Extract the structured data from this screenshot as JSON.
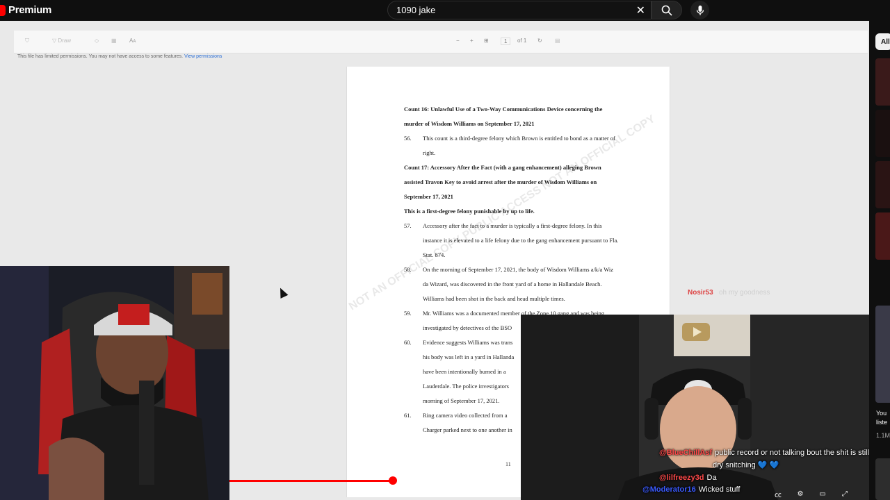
{
  "header": {
    "brand": "Premium",
    "search_value": "1090 jake",
    "icons": {
      "clear": "close-icon",
      "search": "search-icon",
      "voice": "mic-icon"
    }
  },
  "viewer": {
    "toolbar": {
      "draw_label": "Draw",
      "aa_label": "Aᴀ",
      "page_value": "1",
      "page_total": "of 1"
    },
    "notice": "This file has limited permissions. You may not have access to some features.",
    "notice_link": "View permissions"
  },
  "document": {
    "lines": [
      {
        "t": "Count 16: Unlawful Use of a Two-Way Communications Device concerning the",
        "b": true
      },
      {
        "t": "murder of Wisdom Williams on September 17, 2021",
        "b": true
      },
      {
        "n": "56.",
        "t": "This count is a third-degree felony which Brown is entitled to bond as a matter of"
      },
      {
        "t": "right.",
        "i": true
      },
      {
        "t": "Count 17: Accessory After the Fact (with a gang enhancement) alleging Brown",
        "b": true
      },
      {
        "t": "assisted Travon Key to avoid arrest after the murder of Wisdom Williams on",
        "b": true
      },
      {
        "t": "September 17, 2021",
        "b": true
      },
      {
        "t": "This is a first-degree felony punishable by up to life.",
        "b": true
      },
      {
        "n": "57.",
        "t": "Accessory after the fact to a murder is typically a first-degree felony.  In this"
      },
      {
        "t": "instance it is elevated to a life felony due to the gang enhancement pursuant to Fla.",
        "i": true
      },
      {
        "t": "Stat. 874.",
        "i": true
      },
      {
        "n": "58.",
        "t": "On the morning of September 17, 2021, the body of Wisdom Williams a/k/a Wiz"
      },
      {
        "t": "da Wizard, was discovered in the front yard of a home in Hallandale Beach.",
        "i": true
      },
      {
        "t": "Williams had been shot in the back and head multiple times.",
        "i": true
      },
      {
        "n": "59.",
        "t": "Mr. Williams was a documented member of the Zone 10 gang and was being"
      },
      {
        "t": "investigated by detectives of the BSO",
        "i": true
      },
      {
        "n": "60.",
        "t": "Evidence suggests Williams was trans"
      },
      {
        "t": "his body was left in a yard in Hallanda",
        "i": true
      },
      {
        "t": "have been intentionally burned in a",
        "i": true
      },
      {
        "t": "Lauderdale.  The police investigators",
        "i": true
      },
      {
        "t": "morning of September 17, 2021.",
        "i": true
      },
      {
        "n": "61.",
        "t": "Ring camera video collected from a"
      },
      {
        "t": "Charger parked next to one another in",
        "i": true
      }
    ],
    "page_number": "11",
    "watermark": "NOT AN OFFICIAL COPY   PUBLIC ACCESS   NOT AN OFFICIAL COPY"
  },
  "chat": {
    "overlay": {
      "user": "Nosir53",
      "text": "oh my goodness"
    },
    "messages": [
      {
        "user": "@BlueChillAsf",
        "text": "public record or not talking bout the shit is still"
      },
      {
        "user": "",
        "text": "dry snitching 💙 💙"
      },
      {
        "user": "@lilfreezy3d",
        "text": "Da"
      },
      {
        "user": "@Moderator16",
        "text": "Wicked stuff"
      }
    ]
  },
  "player": {
    "progress": 0.56
  },
  "sidebar": {
    "chip_all": "All",
    "texts": [
      "You",
      "liste",
      "1.1M"
    ]
  },
  "colors": {
    "accent": "#ff0000",
    "brand": "#ff0000"
  }
}
